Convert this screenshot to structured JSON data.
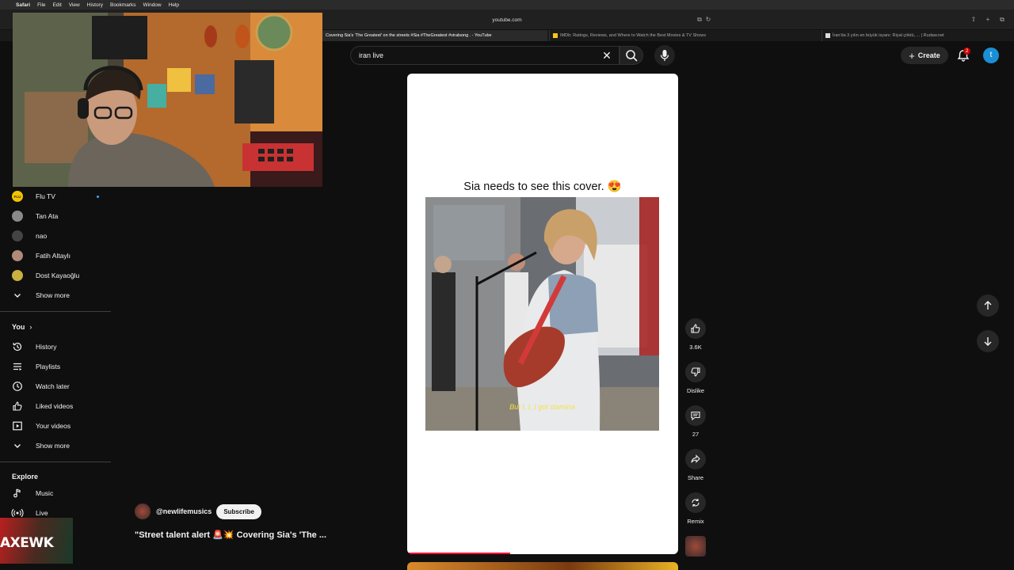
{
  "menubar": {
    "app": "Safari",
    "items": [
      "File",
      "Edit",
      "View",
      "History",
      "Bookmarks",
      "Window",
      "Help"
    ]
  },
  "browser": {
    "address": "youtube.com",
    "tabs": [
      {
        "label": "Covering Sia's 'The Greatest' on the streets #Sia #TheGreatest #viralsong . - YouTube",
        "active": true
      },
      {
        "label": "IMDb: Ratings, Reviews, and Where to Watch the Best Movies & TV Shows",
        "active": false
      },
      {
        "label": "İran'da 3 yılın en büyük isyanı: Riyal çöktü, ... | Rudaw.net",
        "active": false
      }
    ]
  },
  "header": {
    "search_value": "iran live",
    "create_label": "Create",
    "notification_count": "2",
    "avatar_letter": "t"
  },
  "sidebar": {
    "subscriptions": [
      {
        "name": "Flu TV",
        "avatar_color": "#f2c200",
        "avatar_text": "FLU",
        "new": true
      },
      {
        "name": "Tan Ata",
        "avatar_color": "#8a8a8a"
      },
      {
        "name": "nao",
        "avatar_color": "#444444"
      },
      {
        "name": "Fatih Altaylı",
        "avatar_color": "#b08a7a"
      },
      {
        "name": "Dost Kayaoğlu",
        "avatar_color": "#c9b040"
      }
    ],
    "show_more_1": "Show more",
    "you_title": "You",
    "you_items": [
      {
        "label": "History",
        "icon": "history-icon"
      },
      {
        "label": "Playlists",
        "icon": "playlists-icon"
      },
      {
        "label": "Watch later",
        "icon": "watch-later-icon"
      },
      {
        "label": "Liked videos",
        "icon": "liked-icon"
      },
      {
        "label": "Your videos",
        "icon": "your-videos-icon"
      }
    ],
    "show_more_2": "Show more",
    "explore_title": "Explore",
    "explore_items": [
      {
        "label": "Music",
        "icon": "music-icon"
      },
      {
        "label": "Live",
        "icon": "live-icon"
      }
    ]
  },
  "short": {
    "caption": "Sia needs to see this cover. 😍",
    "subtitle": "But I, I, I got stamina",
    "progress": 0.38,
    "channel": "@newlifemusics",
    "subscribe_label": "Subscribe",
    "title": "\"Street talent alert 🚨💥 Covering Sia's 'The ..."
  },
  "actions": {
    "like_count": "3.6K",
    "dislike_label": "Dislike",
    "comment_count": "27",
    "share_label": "Share",
    "remix_label": "Remix"
  },
  "overlay_logo_text": "AXEWK"
}
